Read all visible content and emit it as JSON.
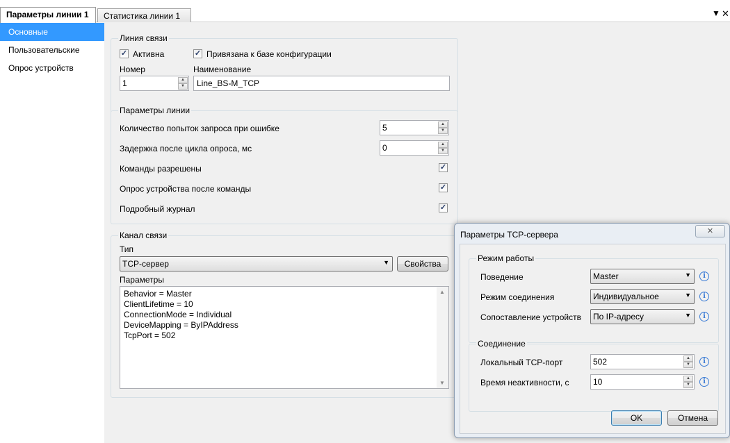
{
  "tabs": [
    {
      "label": "Параметры линии 1"
    },
    {
      "label": "Статистика линии 1"
    }
  ],
  "tab_controls": {
    "menu": "▼",
    "close": "✕"
  },
  "sidebar": {
    "items": [
      {
        "label": "Основные"
      },
      {
        "label": "Пользовательские"
      },
      {
        "label": "Опрос устройств"
      }
    ]
  },
  "comm_line": {
    "title": "Линия связи",
    "active_label": "Активна",
    "bound_label": "Привязана к базе конфигурации",
    "number_label": "Номер",
    "number_value": "1",
    "name_label": "Наименование",
    "name_value": "Line_BS-M_TCP"
  },
  "line_params": {
    "title": "Параметры линии",
    "retries_label": "Количество попыток запроса при ошибке",
    "retries_value": "5",
    "delay_label": "Задержка после цикла опроса, мс",
    "delay_value": "0",
    "cmd_enabled_label": "Команды разрешены",
    "poll_after_cmd_label": "Опрос устройства после команды",
    "detailed_log_label": "Подробный журнал"
  },
  "channel": {
    "title": "Канал связи",
    "type_label": "Тип",
    "type_value": "TCP-сервер",
    "props_button": "Свойства",
    "params_label": "Параметры",
    "params_lines": [
      "Behavior = Master",
      "ClientLifetime = 10",
      "ConnectionMode = Individual",
      "DeviceMapping = ByIPAddress",
      "TcpPort = 502"
    ]
  },
  "dialog": {
    "title": "Параметры TCP-сервера",
    "close_glyph": "✕",
    "mode_group": {
      "title": "Режим работы",
      "behavior_label": "Поведение",
      "behavior_value": "Master",
      "conn_mode_label": "Режим соединения",
      "conn_mode_value": "Индивидуальное",
      "mapping_label": "Сопоставление устройств",
      "mapping_value": "По IP-адресу"
    },
    "connection_group": {
      "title": "Соединение",
      "port_label": "Локальный TCP-порт",
      "port_value": "502",
      "idle_label": "Время неактивности, с",
      "idle_value": "10"
    },
    "ok_button": "OK",
    "cancel_button": "Отмена"
  },
  "glyphs": {
    "check": "✓",
    "arrow_down": "▼",
    "spin_up": "▲",
    "spin_down": "▼",
    "info": "i"
  }
}
